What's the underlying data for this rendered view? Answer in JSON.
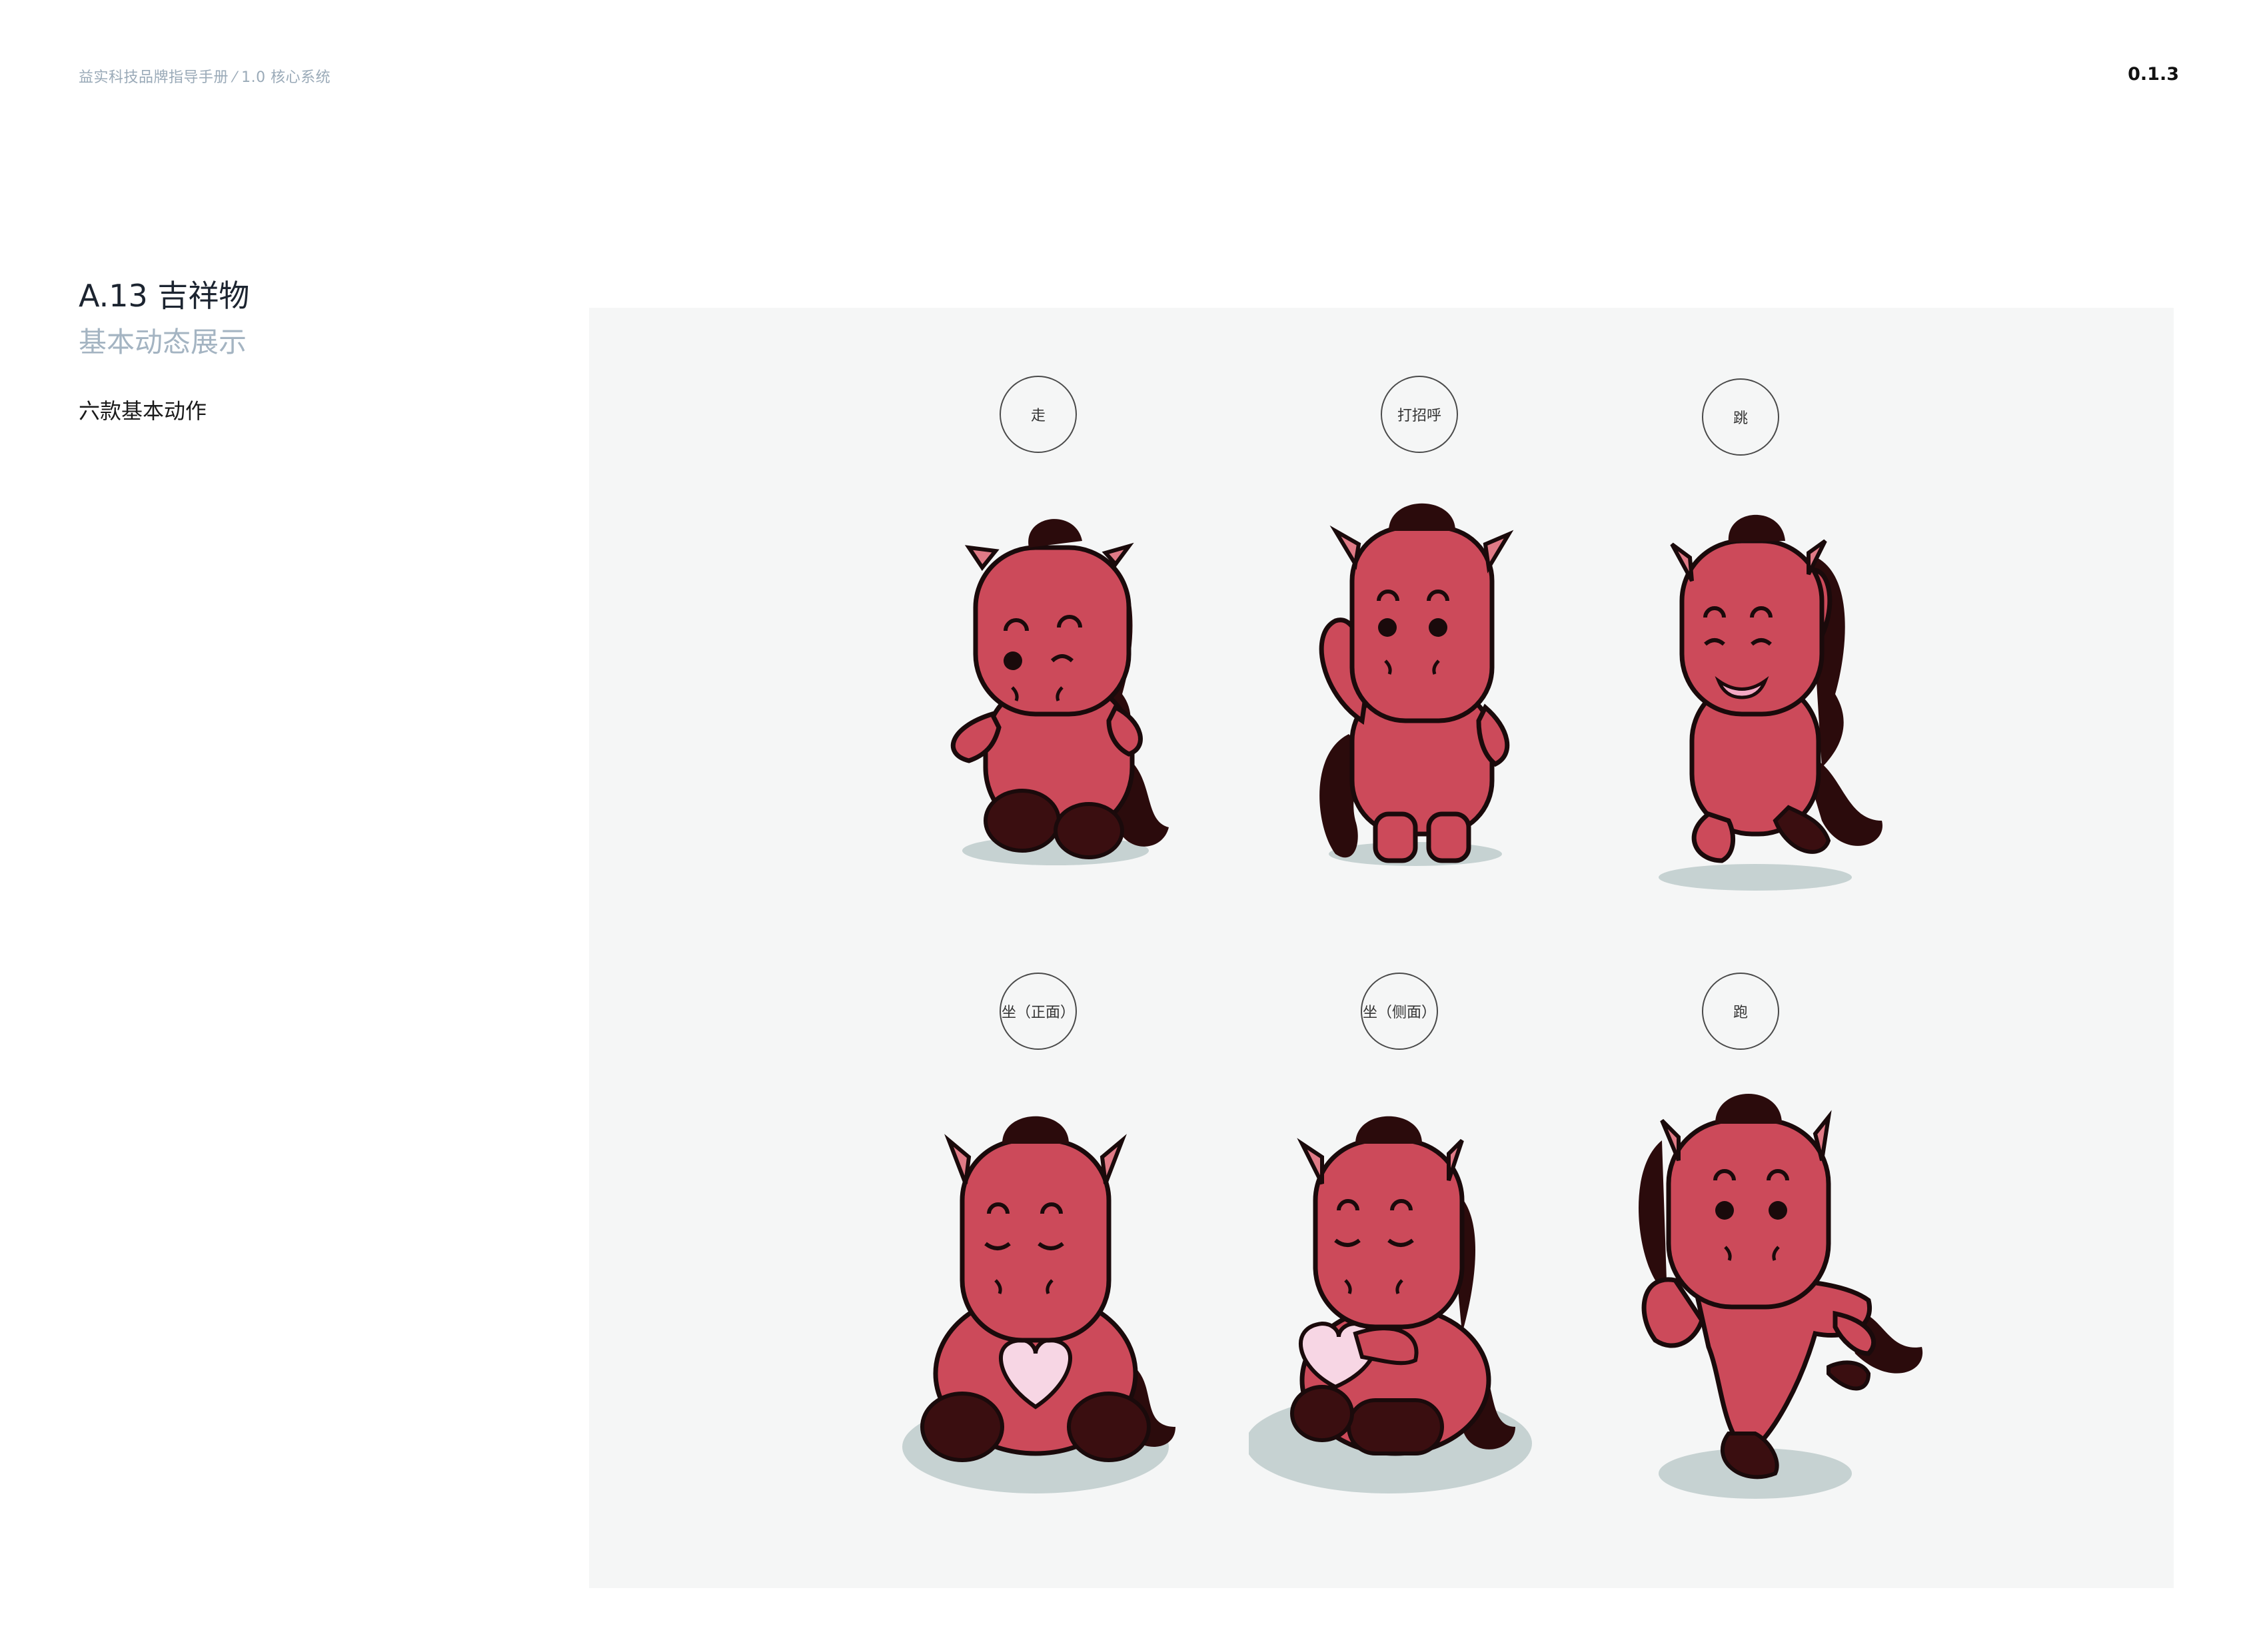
{
  "header": {
    "breadcrumb": "益实科技品牌指导手册 ⁄ 1.0 核心系统",
    "page_number": "0.1.3"
  },
  "section": {
    "title": "A.13 吉祥物",
    "subtitle": "基本动态展示",
    "description": "六款基本动作"
  },
  "poses": [
    {
      "label": "走"
    },
    {
      "label": "打招呼"
    },
    {
      "label": "跳"
    },
    {
      "label": "坐（正面）"
    },
    {
      "label": "坐（侧面）"
    },
    {
      "label": "跑"
    }
  ],
  "colors": {
    "body": "#cc4a5a",
    "body_shade": "#a8323f",
    "mane": "#2b0b0c",
    "outline": "#1a0a0b",
    "shadow": "#c6d2d2",
    "heart": "#f7d6e4",
    "panel": "#f5f6f6"
  }
}
